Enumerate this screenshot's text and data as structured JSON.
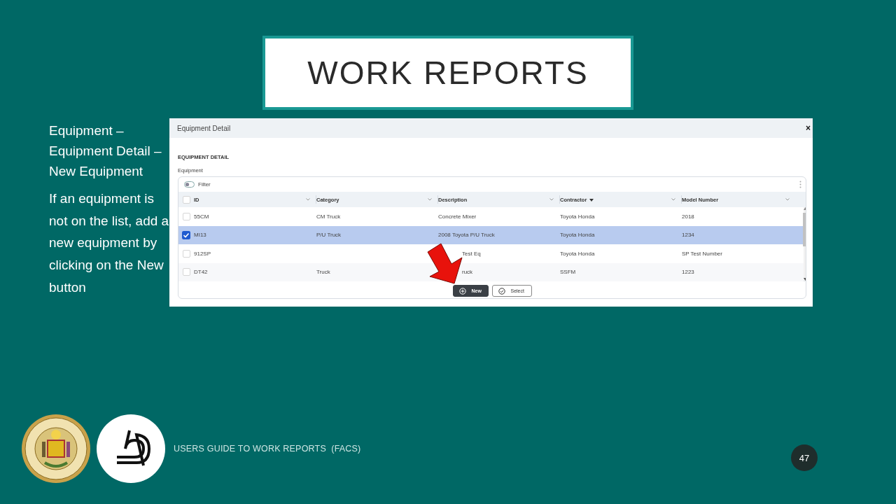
{
  "slide": {
    "title": "WORK REPORTS",
    "heading": "Equipment – Equipment Detail – New Equipment",
    "body": "If an equipment is not on the list, add a new equipment by clicking on the New button",
    "footer": "USERS GUIDE TO WORK REPORTS  (FACS)",
    "page_number": "47"
  },
  "dialog": {
    "title": "Equipment Detail",
    "close": "×",
    "section": "EQUIPMENT DETAIL",
    "field_label": "Equipment",
    "filter": {
      "label": "Filter",
      "on": false
    },
    "select_all": false,
    "columns": [
      {
        "label": "ID",
        "sorted": false
      },
      {
        "label": "Category",
        "sorted": false
      },
      {
        "label": "Description",
        "sorted": false
      },
      {
        "label": "Contractor",
        "sorted": true
      },
      {
        "label": "Model Number",
        "sorted": false
      }
    ],
    "rows": [
      {
        "selected": false,
        "covered": false,
        "cells": [
          "55CM",
          "CM Truck",
          "Concrete Mixer",
          "Toyota Honda",
          "2018"
        ]
      },
      {
        "selected": true,
        "covered": false,
        "cells": [
          "MI13",
          "P/U Truck",
          "2008 Toyota P/U Truck",
          "Toyota Honda",
          "1234"
        ]
      },
      {
        "selected": false,
        "covered": true,
        "cells": [
          "912SP",
          "",
          "Test Eq",
          "Toyota Honda",
          "SP Test Number"
        ]
      },
      {
        "selected": false,
        "covered": true,
        "cells": [
          "DT42",
          "Truck",
          "ruck",
          "SSFM",
          "1223"
        ]
      }
    ],
    "buttons": [
      {
        "label": "New",
        "kind": "primary"
      },
      {
        "label": "Select",
        "kind": "secondary"
      }
    ]
  }
}
